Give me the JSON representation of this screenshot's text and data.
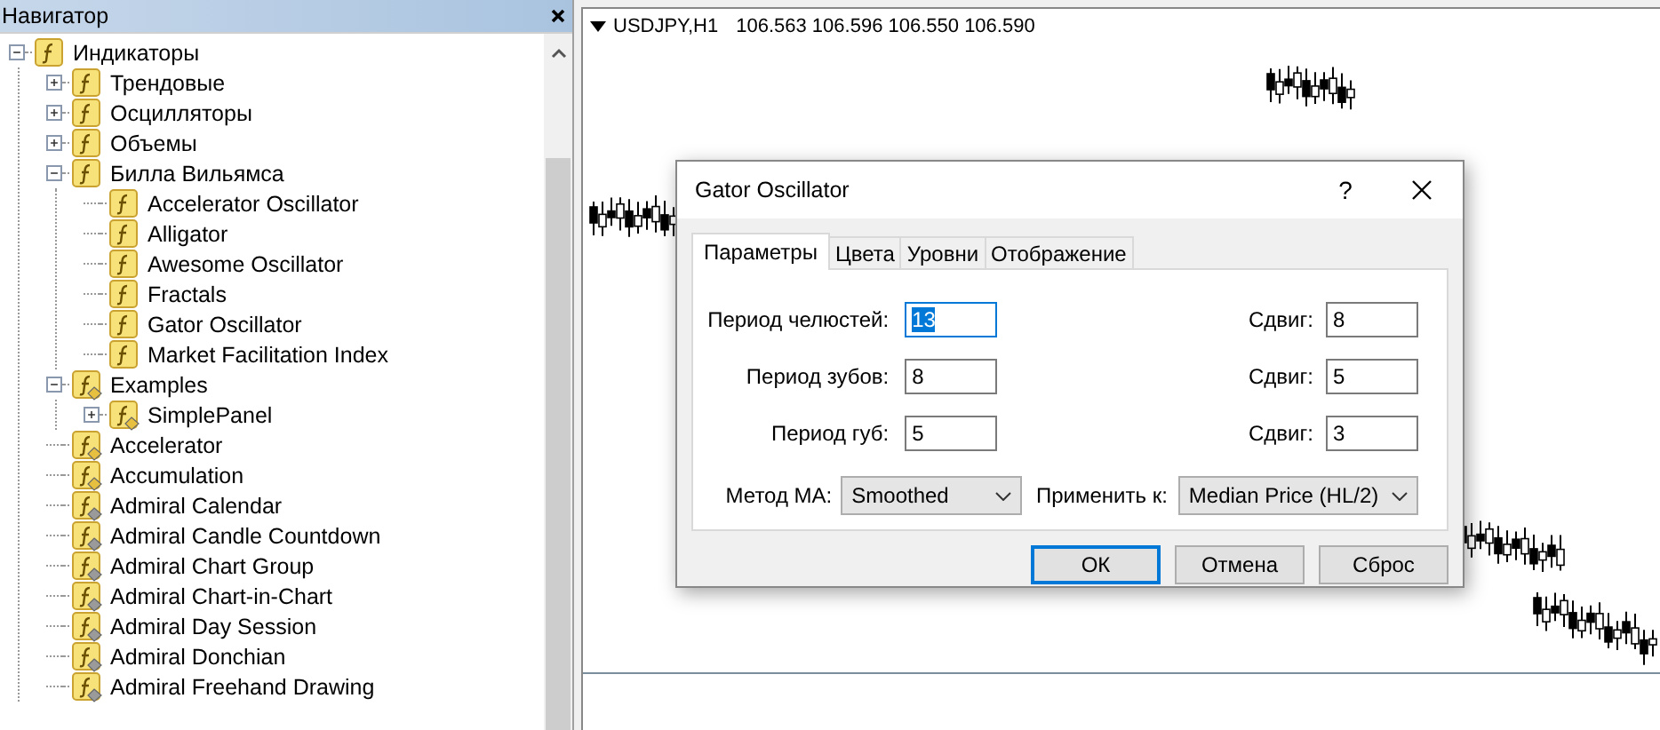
{
  "navigator": {
    "title": "Навигатор",
    "tree": [
      {
        "label": "Индикаторы",
        "kind": "builtin",
        "expanded": true,
        "children": [
          {
            "label": "Трендовые",
            "kind": "builtin",
            "expanded": false
          },
          {
            "label": "Осцилляторы",
            "kind": "builtin",
            "expanded": false
          },
          {
            "label": "Объемы",
            "kind": "builtin",
            "expanded": false
          },
          {
            "label": "Билла Вильямса",
            "kind": "builtin",
            "expanded": true,
            "children": [
              {
                "label": "Accelerator Oscillator",
                "kind": "builtin"
              },
              {
                "label": "Alligator",
                "kind": "builtin"
              },
              {
                "label": "Awesome Oscillator",
                "kind": "builtin"
              },
              {
                "label": "Fractals",
                "kind": "builtin"
              },
              {
                "label": "Gator Oscillator",
                "kind": "builtin"
              },
              {
                "label": "Market Facilitation Index",
                "kind": "builtin"
              }
            ]
          },
          {
            "label": "Examples",
            "kind": "source",
            "expanded": true,
            "children": [
              {
                "label": "SimplePanel",
                "kind": "source",
                "expanded": false
              }
            ]
          },
          {
            "label": "Accelerator",
            "kind": "source"
          },
          {
            "label": "Accumulation",
            "kind": "source"
          },
          {
            "label": "Admiral Calendar",
            "kind": "compiled"
          },
          {
            "label": "Admiral Candle Countdown",
            "kind": "compiled"
          },
          {
            "label": "Admiral Chart Group",
            "kind": "compiled"
          },
          {
            "label": "Admiral Chart-in-Chart",
            "kind": "compiled"
          },
          {
            "label": "Admiral Day Session",
            "kind": "compiled"
          },
          {
            "label": "Admiral Donchian",
            "kind": "compiled"
          },
          {
            "label": "Admiral Freehand Drawing",
            "kind": "compiled"
          }
        ]
      }
    ]
  },
  "chart": {
    "symbol": "USDJPY,H1",
    "prices": "106.563 106.596 106.550 106.590"
  },
  "dialog": {
    "title": "Gator Oscillator",
    "help": "?",
    "tabs": [
      {
        "label": "Параметры",
        "selected": true
      },
      {
        "label": "Цвета",
        "selected": false
      },
      {
        "label": "Уровни",
        "selected": false
      },
      {
        "label": "Отображение",
        "selected": false
      }
    ],
    "rows": [
      {
        "period": {
          "label": "Период челюстей:",
          "value": "13",
          "focused": true
        },
        "shift": {
          "label": "Сдвиг:",
          "value": "8",
          "focused": false
        }
      },
      {
        "period": {
          "label": "Период зубов:",
          "value": "8",
          "focused": false
        },
        "shift": {
          "label": "Сдвиг:",
          "value": "5",
          "focused": false
        }
      },
      {
        "period": {
          "label": "Период губ:",
          "value": "5",
          "focused": false
        },
        "shift": {
          "label": "Сдвиг:",
          "value": "3",
          "focused": false
        }
      }
    ],
    "selects": [
      {
        "label": "Метод МА:",
        "value": "Smoothed"
      },
      {
        "label": "Применить к:",
        "value": "Median Price (HL/2)"
      }
    ],
    "buttons": [
      {
        "label": "ОК",
        "default": true
      },
      {
        "label": "Отмена",
        "default": false
      },
      {
        "label": "Сброс",
        "default": false
      }
    ]
  }
}
